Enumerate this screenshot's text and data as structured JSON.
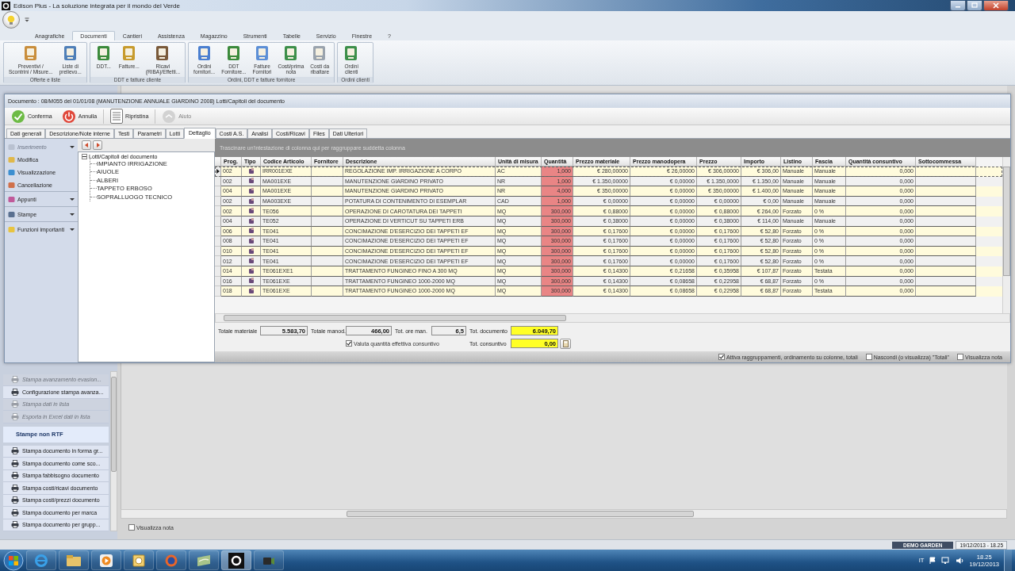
{
  "window": {
    "title": "Edison Plus - La soluzione integrata per il mondo del Verde"
  },
  "ribbon": {
    "tabs": [
      {
        "label": "Anagrafiche",
        "selected": false
      },
      {
        "label": "Documenti",
        "selected": true
      },
      {
        "label": "Cantieri",
        "selected": false
      },
      {
        "label": "Assistenza",
        "selected": false
      },
      {
        "label": "Magazzino",
        "selected": false
      },
      {
        "label": "Strumenti",
        "selected": false
      },
      {
        "label": "Tabelle",
        "selected": false
      },
      {
        "label": "Servizio",
        "selected": false
      },
      {
        "label": "Finestre",
        "selected": false
      },
      {
        "label": "?",
        "selected": false
      }
    ],
    "groups": [
      {
        "title": "Offerte e liste",
        "buttons": [
          "Preventivi /\nScontrini / Misure...",
          "Liste di\nprelievo..."
        ]
      },
      {
        "title": "DDT e fatture cliente",
        "buttons": [
          "DDT...",
          "Fatture...",
          "Ricavi\n(RIBA)/Effetti..."
        ]
      },
      {
        "title": "Ordini, DDT e fatture fornitore",
        "buttons": [
          "Ordini\nfornitori...",
          "DDT\nFornitore...",
          "Fatture\nFornitori",
          "Costi/prima\nnota",
          "Costi da\nribaltare"
        ]
      },
      {
        "title": "Ordini clienti",
        "buttons": [
          "Ordini\nclienti"
        ]
      }
    ]
  },
  "document": {
    "title": "Documento : 08/M055 del 01/01/08 (MANUTENZIONE ANNUALE GIARDINO 2008) Lotti/Capitoli del documento",
    "toolbar": [
      {
        "label": "Conferma",
        "disabled": false
      },
      {
        "label": "Annulla",
        "disabled": false
      },
      {
        "label": "Ripristina",
        "disabled": false
      },
      {
        "label": "Aiuto",
        "disabled": true
      }
    ],
    "tabs": [
      {
        "label": "Dati generali",
        "selected": false
      },
      {
        "label": "Descrizione/Note interne",
        "selected": false
      },
      {
        "label": "Testi",
        "selected": false
      },
      {
        "label": "Parametri",
        "selected": false
      },
      {
        "label": "Lotti",
        "selected": false
      },
      {
        "label": "Dettaglio",
        "selected": true
      },
      {
        "label": "Costi A.S.",
        "selected": false
      },
      {
        "label": "Analisi",
        "selected": false
      },
      {
        "label": "Costi/Ricavi",
        "selected": false
      },
      {
        "label": "Files",
        "selected": false
      },
      {
        "label": "Dati Ulteriori",
        "selected": false
      }
    ],
    "side_menu": [
      {
        "kind": "action",
        "label": "Inserimento",
        "disabled": true
      },
      {
        "kind": "action",
        "label": "Modifica",
        "disabled": false
      },
      {
        "kind": "action",
        "label": "Visualizzazione",
        "disabled": false
      },
      {
        "kind": "action",
        "label": "Cancellazione",
        "disabled": false
      },
      {
        "kind": "dropdown",
        "label": "Appunti",
        "disabled": false
      },
      {
        "kind": "dropdown",
        "label": "Stampe",
        "disabled": false
      },
      {
        "kind": "dropdown",
        "label": "Funzioni importanti",
        "disabled": false
      }
    ],
    "tree": {
      "label": "Lotti/Capitoli del documento",
      "expanded": true,
      "children": [
        {
          "label": "IMPIANTO IRRIGAZIONE"
        },
        {
          "label": "AIUOLE"
        },
        {
          "label": "ALBERI"
        },
        {
          "label": "TAPPETO ERBOSO"
        },
        {
          "label": "SOPRALLUOGO TECNICO"
        }
      ]
    },
    "grid": {
      "group_hint": "Trascinare un'intestazione di colonna qui per raggruppare suddetta colonna",
      "columns": [
        "Prog.",
        "Tipo",
        "Codice Articolo",
        "Fornitore",
        "Descrizione",
        "Unità di misura",
        "Quantità",
        "Prezzo materiale",
        "Prezzo manodopera",
        "Prezzo",
        "Importo",
        "Listino",
        "Fascia",
        "Quantità consuntivo",
        "Sottocommessa"
      ],
      "rows": [
        {
          "selected": true,
          "prog": "002",
          "code": "IRR001EXE",
          "description": "REGOLAZIONE IMP. IRRIGAZIONE A CORPO",
          "unit": "AC",
          "quantity": "1,000",
          "material_price": "€ 280,00000",
          "labour_price": "€ 26,00000",
          "price": "€ 306,00000",
          "amount": "€ 306,00",
          "list": "Manuale",
          "band": "Manuale",
          "actual_quantity": "0,000"
        },
        {
          "selected": false,
          "prog": "002",
          "code": "MA001EXE",
          "description": "MANUTENZIONE GIARDINO PRIVATO",
          "unit": "NR",
          "quantity": "1,000",
          "material_price": "€ 1.350,00000",
          "labour_price": "€ 0,00000",
          "price": "€ 1.350,0000",
          "amount": "€ 1.350,00",
          "list": "Manuale",
          "band": "Manuale",
          "actual_quantity": "0,000"
        },
        {
          "selected": false,
          "prog": "004",
          "code": "MA001EXE",
          "description": "MANUTENZIONE GIARDINO PRIVATO",
          "unit": "NR",
          "quantity": "4,000",
          "material_price": "€ 350,00000",
          "labour_price": "€ 0,00000",
          "price": "€ 350,00000",
          "amount": "€ 1.400,00",
          "list": "Manuale",
          "band": "Manuale",
          "actual_quantity": "0,000"
        },
        {
          "selected": false,
          "prog": "002",
          "code": "MA003EXE",
          "description": "POTATURA DI CONTENIMENTO DI ESEMPLAR",
          "unit": "CAD",
          "quantity": "1,000",
          "material_price": "€ 0,00000",
          "labour_price": "€ 0,00000",
          "price": "€ 0,00000",
          "amount": "€ 0,00",
          "list": "Manuale",
          "band": "Manuale",
          "actual_quantity": "0,000"
        },
        {
          "selected": false,
          "prog": "002",
          "code": "TE056",
          "description": "OPERAZIONE DI CAROTATURA DEI TAPPETI",
          "unit": "MQ",
          "quantity": "300,000",
          "material_price": "€ 0,88000",
          "labour_price": "€ 0,00000",
          "price": "€ 0,88000",
          "amount": "€ 264,00",
          "list": "Forzato",
          "band": "0 %",
          "actual_quantity": "0,000"
        },
        {
          "selected": false,
          "prog": "004",
          "code": "TE052",
          "description": "OPERAZIONE DI VERTICUT SU TAPPETI ERB",
          "unit": "MQ",
          "quantity": "300,000",
          "material_price": "€ 0,38000",
          "labour_price": "€ 0,00000",
          "price": "€ 0,38000",
          "amount": "€ 114,00",
          "list": "Manuale",
          "band": "Manuale",
          "actual_quantity": "0,000"
        },
        {
          "selected": false,
          "prog": "006",
          "code": "TE041",
          "description": "CONCIMAZIONE D'ESERCIZIO DEI TAPPETI EF",
          "unit": "MQ",
          "quantity": "300,000",
          "material_price": "€ 0,17600",
          "labour_price": "€ 0,00000",
          "price": "€ 0,17600",
          "amount": "€ 52,80",
          "list": "Forzato",
          "band": "0 %",
          "actual_quantity": "0,000"
        },
        {
          "selected": false,
          "prog": "008",
          "code": "TE041",
          "description": "CONCIMAZIONE D'ESERCIZIO DEI TAPPETI EF",
          "unit": "MQ",
          "quantity": "300,000",
          "material_price": "€ 0,17600",
          "labour_price": "€ 0,00000",
          "price": "€ 0,17600",
          "amount": "€ 52,80",
          "list": "Forzato",
          "band": "0 %",
          "actual_quantity": "0,000"
        },
        {
          "selected": false,
          "prog": "010",
          "code": "TE041",
          "description": "CONCIMAZIONE D'ESERCIZIO DEI TAPPETI EF",
          "unit": "MQ",
          "quantity": "300,000",
          "material_price": "€ 0,17600",
          "labour_price": "€ 0,00000",
          "price": "€ 0,17600",
          "amount": "€ 52,80",
          "list": "Forzato",
          "band": "0 %",
          "actual_quantity": "0,000"
        },
        {
          "selected": false,
          "prog": "012",
          "code": "TE041",
          "description": "CONCIMAZIONE D'ESERCIZIO DEI TAPPETI EF",
          "unit": "MQ",
          "quantity": "300,000",
          "material_price": "€ 0,17600",
          "labour_price": "€ 0,00000",
          "price": "€ 0,17600",
          "amount": "€ 52,80",
          "list": "Forzato",
          "band": "0 %",
          "actual_quantity": "0,000"
        },
        {
          "selected": false,
          "prog": "014",
          "code": "TE061EXE1",
          "description": "TRATTAMENTO FUNGINEO FINO A 300 MQ",
          "unit": "MQ",
          "quantity": "300,000",
          "material_price": "€ 0,14300",
          "labour_price": "€ 0,21658",
          "price": "€ 0,35958",
          "amount": "€ 107,87",
          "list": "Forzato",
          "band": "Testata",
          "actual_quantity": "0,000"
        },
        {
          "selected": false,
          "prog": "016",
          "code": "TE061EXE",
          "description": "TRATTAMENTO FUNGINEO 1000-2000 MQ",
          "unit": "MQ",
          "quantity": "300,000",
          "material_price": "€ 0,14300",
          "labour_price": "€ 0,08658",
          "price": "€ 0,22958",
          "amount": "€ 68,87",
          "list": "Forzato",
          "band": "0 %",
          "actual_quantity": "0,000"
        },
        {
          "selected": false,
          "prog": "018",
          "code": "TE061EXE",
          "description": "TRATTAMENTO FUNGINEO 1000-2000 MQ",
          "unit": "MQ",
          "quantity": "300,000",
          "material_price": "€ 0,14300",
          "labour_price": "€ 0,08658",
          "price": "€ 0,22958",
          "amount": "€ 68,87",
          "list": "Forzato",
          "band": "Testata",
          "actual_quantity": "0,000"
        }
      ]
    },
    "totals": [
      {
        "label": "Totale materiale",
        "value": "5.583,70",
        "highlight": false
      },
      {
        "label": "Totale manod.",
        "value": "466,00",
        "highlight": false
      },
      {
        "label": "Tot. ore man.",
        "value": "6,5",
        "highlight": false
      },
      {
        "label": "Tot. documento",
        "value": "6.049,70",
        "highlight": true
      }
    ],
    "valuta_check": {
      "label": "Valuta quantità effettiva consuntivo",
      "checked": true
    },
    "consuntivo": {
      "label": "Tot. consuntivo",
      "value": "0,00",
      "highlight": true
    },
    "options": [
      {
        "label": "Attiva raggruppamenti, ordinamento su colonne, totali",
        "checked": true
      },
      {
        "label": "Nascondi (o visualizza) \"Totali\"",
        "checked": false
      },
      {
        "label": "Visualizza nota",
        "checked": false
      }
    ]
  },
  "background": {
    "print_menu": [
      {
        "kind": "item",
        "label": "Stampa avanzamento evasion...",
        "disabled": true
      },
      {
        "kind": "item",
        "label": "Configurazione stampa avanza...",
        "disabled": false
      },
      {
        "kind": "item",
        "label": "Stampa dati in lista",
        "disabled": true
      },
      {
        "kind": "item",
        "label": "Esporta in Excel dati in lista",
        "disabled": true
      },
      {
        "kind": "header",
        "label": "Stampe non RTF"
      },
      {
        "kind": "item",
        "label": "Stampa documento in forma gr...",
        "disabled": false
      },
      {
        "kind": "item",
        "label": "Stampa documento come sco...",
        "disabled": false
      },
      {
        "kind": "item",
        "label": "Stampa fabbisogno documento",
        "disabled": false
      },
      {
        "kind": "item",
        "label": "Stampa costi/ricavi documento",
        "disabled": false
      },
      {
        "kind": "item",
        "label": "Stampa costi/prezzi documento",
        "disabled": false
      },
      {
        "kind": "item",
        "label": "Stampa documento per marca",
        "disabled": false
      },
      {
        "kind": "item",
        "label": "Stampa documento per grupp...",
        "disabled": false
      }
    ],
    "note_check": {
      "label": "Visualizza nota",
      "checked": false
    }
  },
  "status_bar": {
    "company": "DEMO GARDEN",
    "datetime": "19/12/2013 - 18.25"
  },
  "taskbar": {
    "language": "IT",
    "time": "18.25",
    "date": "19/12/2013"
  }
}
